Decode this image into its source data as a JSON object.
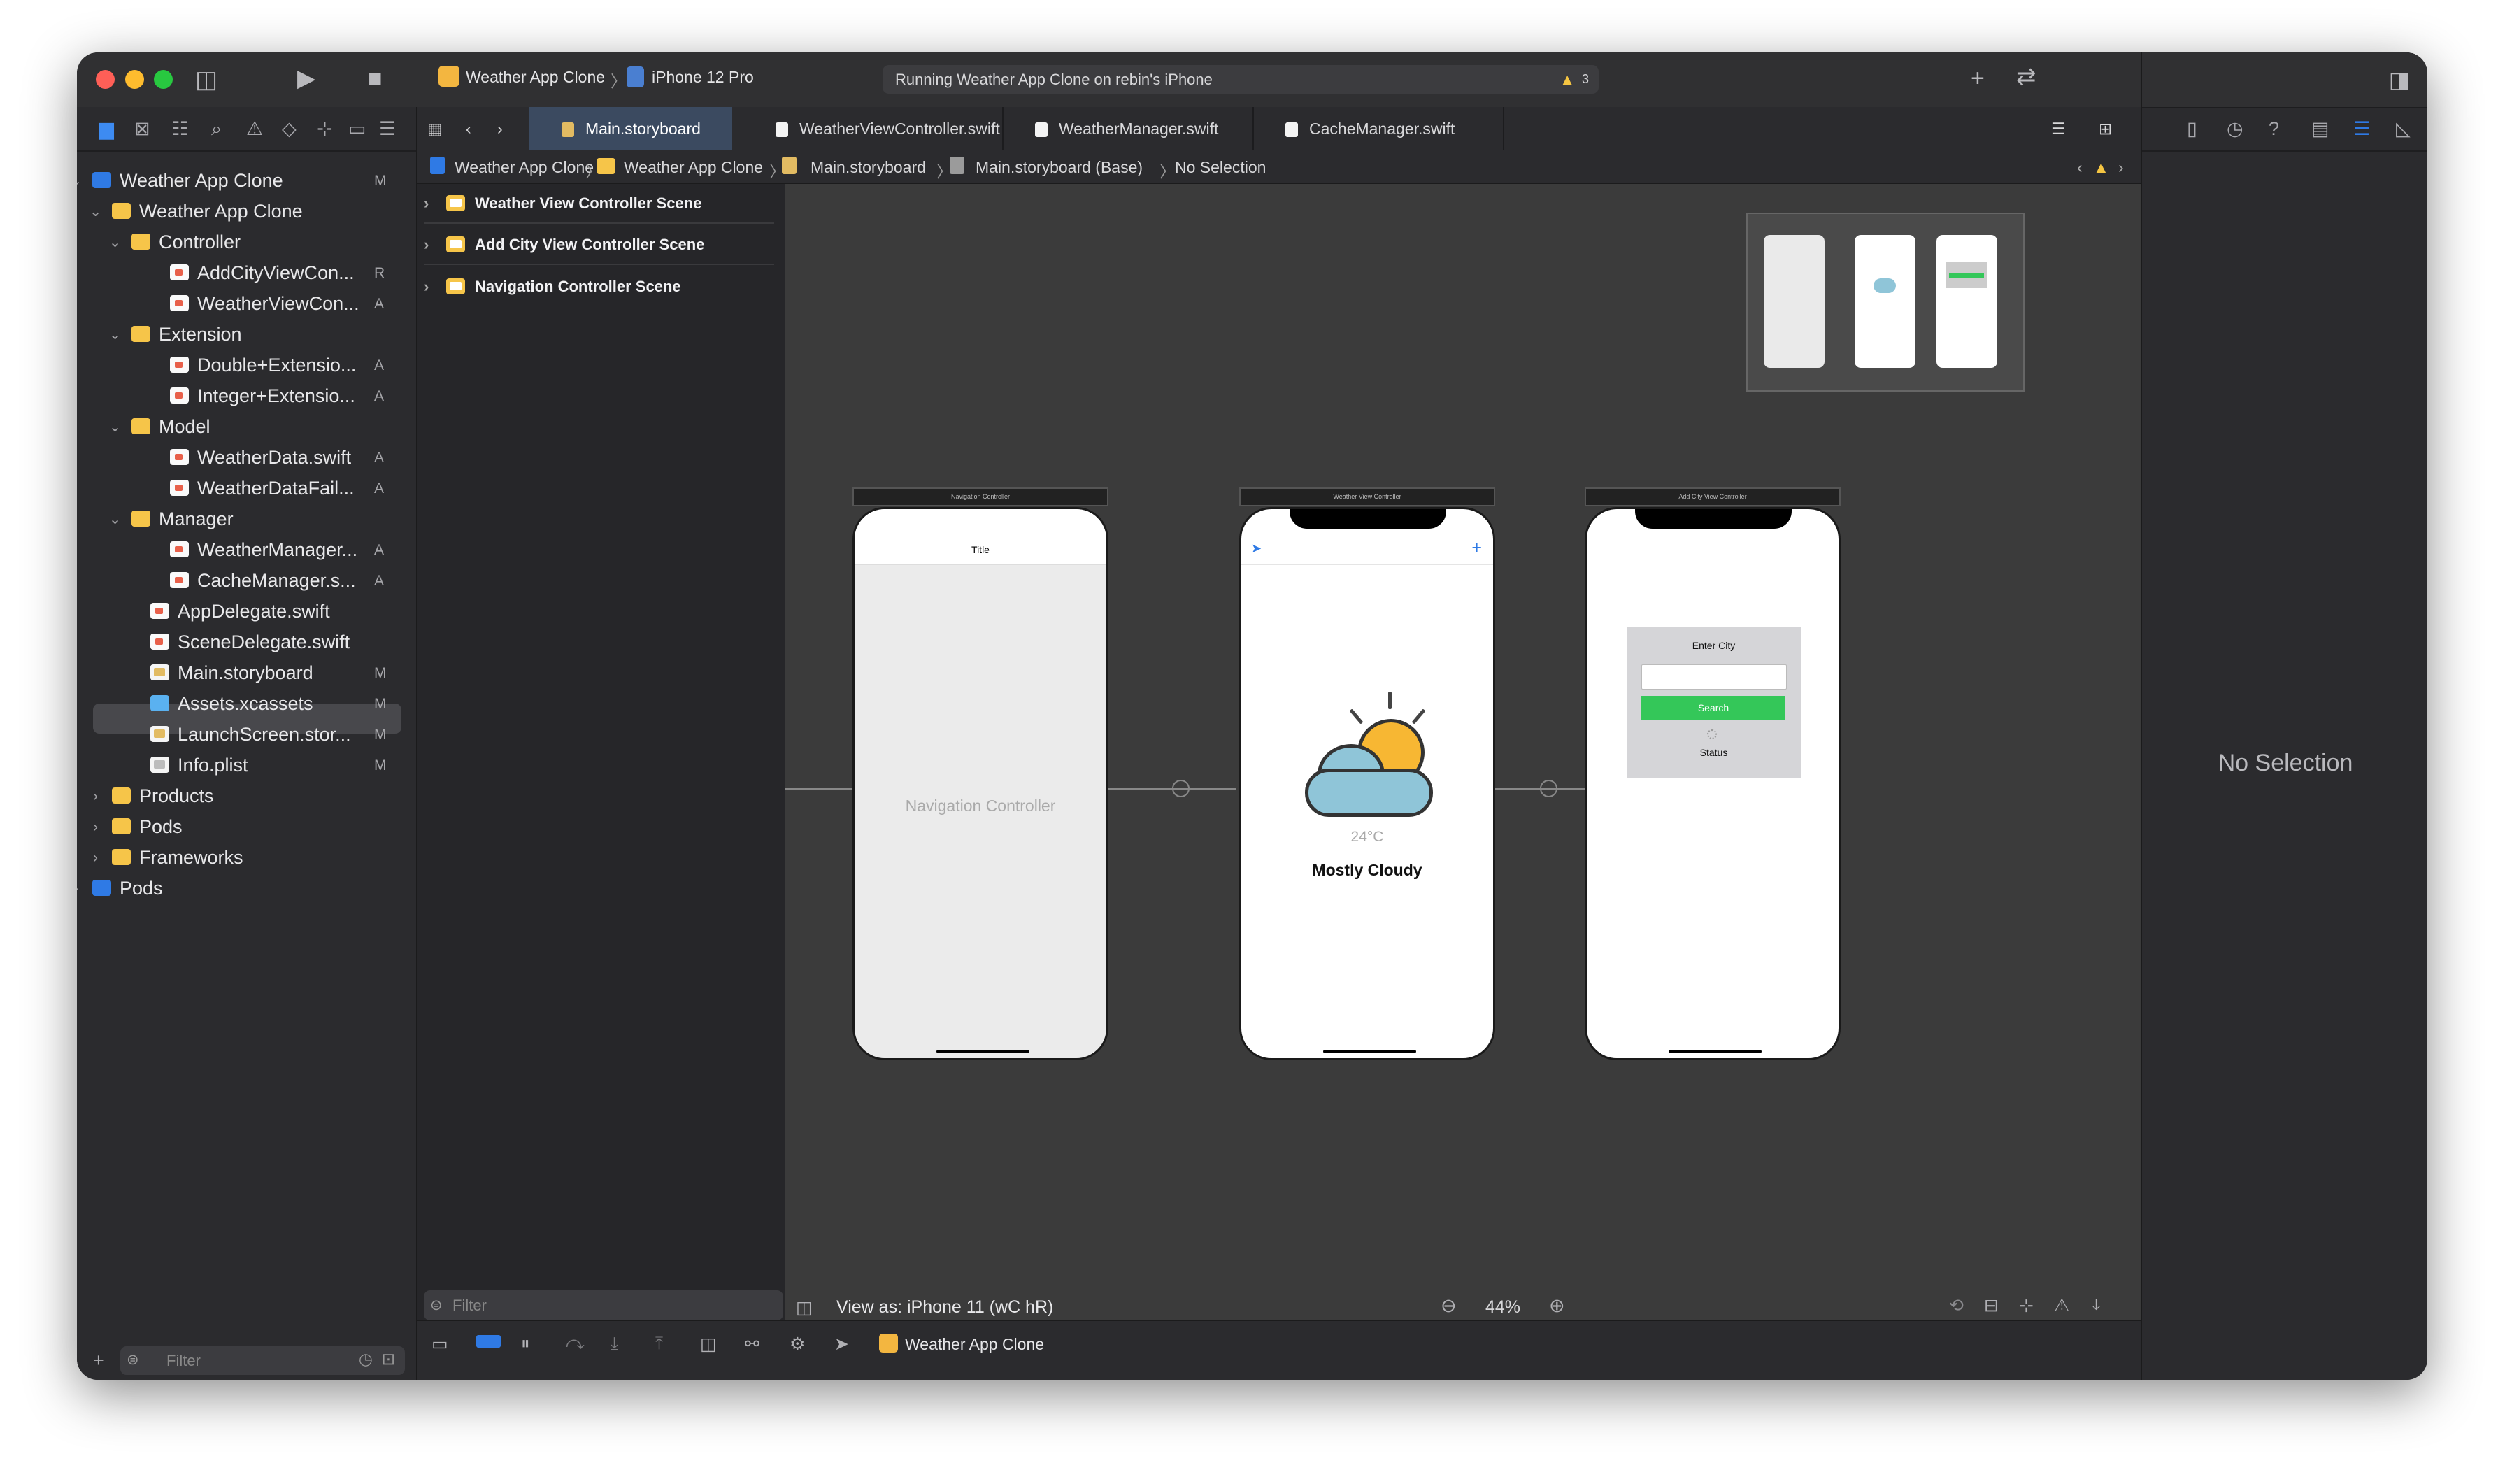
{
  "toolbar": {
    "scheme": "Weather App Clone",
    "device": "iPhone 12 Pro",
    "status": "Running Weather App Clone on rebin's iPhone",
    "warning_count": "3"
  },
  "navigator": {
    "items": [
      {
        "label": "Weather App Clone",
        "status": "M"
      },
      {
        "label": "Weather App Clone",
        "status": ""
      },
      {
        "label": "Controller",
        "status": ""
      },
      {
        "label": "AddCityViewCon...",
        "status": "R"
      },
      {
        "label": "WeatherViewCon...",
        "status": "A"
      },
      {
        "label": "Extension",
        "status": ""
      },
      {
        "label": "Double+Extensio...",
        "status": "A"
      },
      {
        "label": "Integer+Extensio...",
        "status": "A"
      },
      {
        "label": "Model",
        "status": ""
      },
      {
        "label": "WeatherData.swift",
        "status": "A"
      },
      {
        "label": "WeatherDataFail...",
        "status": "A"
      },
      {
        "label": "Manager",
        "status": ""
      },
      {
        "label": "WeatherManager...",
        "status": "A"
      },
      {
        "label": "CacheManager.s...",
        "status": "A"
      },
      {
        "label": "AppDelegate.swift",
        "status": ""
      },
      {
        "label": "SceneDelegate.swift",
        "status": ""
      },
      {
        "label": "Main.storyboard",
        "status": "M"
      },
      {
        "label": "Assets.xcassets",
        "status": "M"
      },
      {
        "label": "LaunchScreen.stor...",
        "status": "M"
      },
      {
        "label": "Info.plist",
        "status": "M"
      },
      {
        "label": "Products",
        "status": ""
      },
      {
        "label": "Pods",
        "status": ""
      },
      {
        "label": "Frameworks",
        "status": ""
      },
      {
        "label": "Pods",
        "status": ""
      }
    ],
    "filter_placeholder": "Filter"
  },
  "tabs": [
    "Main.storyboard",
    "WeatherViewController.swift",
    "WeatherManager.swift",
    "CacheManager.swift"
  ],
  "jumpbar": [
    "Weather App Clone",
    "Weather App Clone",
    "Main.storyboard",
    "Main.storyboard (Base)",
    "No Selection"
  ],
  "outline": {
    "scenes": [
      "Weather View Controller Scene",
      "Add City View Controller Scene",
      "Navigation Controller Scene"
    ],
    "filter_placeholder": "Filter"
  },
  "canvas": {
    "nav_header": "Navigation Controller",
    "nav_title": "Title",
    "nav_body": "Navigation Controller",
    "weather_header": "Weather View Controller",
    "temperature": "24°C",
    "condition": "Mostly Cloudy",
    "addcity_header": "Add City View Controller",
    "enter_city": "Enter City",
    "search_btn": "Search",
    "status_lbl": "Status"
  },
  "bottombar": {
    "view_as": "View as: iPhone 11 (wC hR)",
    "zoom": "44%"
  },
  "debug": {
    "target": "Weather App Clone"
  },
  "inspector": {
    "empty": "No Selection"
  },
  "colors": {
    "accent": "#2f7ae5",
    "search_green": "#34c759",
    "folder": "#f6c549",
    "sun": "#f7b733",
    "cloud": "#8fc5d8"
  }
}
